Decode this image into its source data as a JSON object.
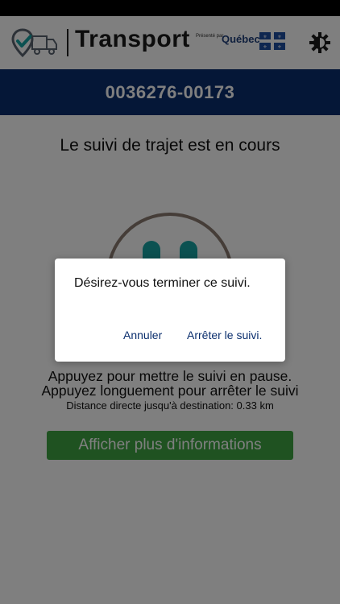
{
  "header": {
    "title": "Transport",
    "presented_by": "Présenté par",
    "brand": "Québec",
    "logo_icon": "truck-location-icon",
    "settings_icon": "brightness-icon"
  },
  "trip": {
    "id": "0036276-00173"
  },
  "main": {
    "status_heading": "Le suivi de trajet est en cours",
    "instruction_pause": "Appuyez pour mettre le suivi en pause.",
    "instruction_stop": "Appuyez longuement pour arrêter le suivi",
    "distance_line": "Distance directe jusqu'à destination: 0.33 km",
    "more_info_label": "Afficher plus d'informations"
  },
  "dialog": {
    "message": "Désirez-vous terminer ce suivi.",
    "cancel_label": "Annuler",
    "confirm_label": "Arrêter le suivi."
  },
  "colors": {
    "header_bar": "#0b2f6e",
    "button_green": "#3ea543",
    "face_eyes": "#17a3a3",
    "face_outline": "#8a7a70"
  }
}
